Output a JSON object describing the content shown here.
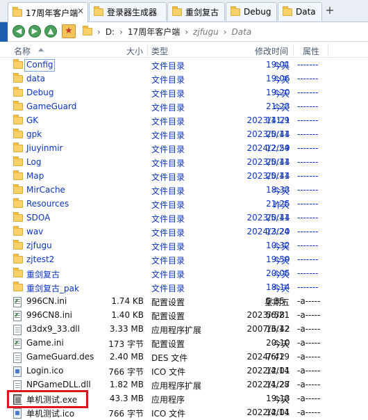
{
  "tabs": [
    {
      "label": "17周年客户端",
      "active": true
    },
    {
      "label": "登录器生成器",
      "active": false
    },
    {
      "label": "重剑复古",
      "active": false
    },
    {
      "label": "Debug",
      "active": false
    },
    {
      "label": "Data",
      "active": false
    }
  ],
  "tab_close_glyph": "✕",
  "tab_add_glyph": "+",
  "address": {
    "drive": "D:",
    "seg1": "17周年客户端",
    "seg2": "zjfugu",
    "seg3": "Data",
    "separator": "›"
  },
  "columns": {
    "name": "名称",
    "size": "大小",
    "type": "类型",
    "modified": "修改时间",
    "attr": "属性"
  },
  "folders": [
    {
      "name": "Config",
      "type": "文件目录",
      "date": "今天",
      "time": "19:01",
      "attr": "-------"
    },
    {
      "name": "data",
      "type": "文件目录",
      "date": "今天",
      "time": "19:06",
      "attr": "-------"
    },
    {
      "name": "Debug",
      "type": "文件目录",
      "date": "今天",
      "time": "19:20",
      "attr": "-------"
    },
    {
      "name": "GameGuard",
      "type": "文件目录",
      "date": "今天",
      "time": "21:23",
      "attr": "-------"
    },
    {
      "name": "GK",
      "type": "文件目录",
      "date": "2023/11/9",
      "time": "14:21",
      "attr": "-------"
    },
    {
      "name": "gpk",
      "type": "文件目录",
      "date": "2023/5/11",
      "time": "20:44",
      "attr": "-------"
    },
    {
      "name": "Jiuyinmir",
      "type": "文件目录",
      "date": "2024/2/24",
      "time": "12:59",
      "attr": "-------"
    },
    {
      "name": "Log",
      "type": "文件目录",
      "date": "2023/5/11",
      "time": "20:44",
      "attr": "-------"
    },
    {
      "name": "Map",
      "type": "文件目录",
      "date": "2023/5/11",
      "time": "20:44",
      "attr": "-------"
    },
    {
      "name": "MirCache",
      "type": "文件目录",
      "date": "今天",
      "time": "18:33",
      "attr": "-------"
    },
    {
      "name": "Resources",
      "type": "文件目录",
      "date": "昨天",
      "time": "21:25",
      "attr": "-------"
    },
    {
      "name": "SDOA",
      "type": "文件目录",
      "date": "2023/5/11",
      "time": "20:44",
      "attr": "-------"
    },
    {
      "name": "wav",
      "type": "文件目录",
      "date": "2024/2/24",
      "time": "13:20",
      "attr": "-------"
    },
    {
      "name": "zjfugu",
      "type": "文件目录",
      "date": "今天",
      "time": "10:32",
      "attr": "-------"
    },
    {
      "name": "zjtest2",
      "type": "文件目录",
      "date": "今天",
      "time": "19:59",
      "attr": "-------"
    },
    {
      "name": "重剑复古",
      "type": "文件目录",
      "date": "今天",
      "time": "20:05",
      "attr": "-------"
    },
    {
      "name": "重剑复古_pak",
      "type": "文件目录",
      "date": "今天",
      "time": "18:14",
      "attr": "-------"
    }
  ],
  "files": [
    {
      "name": "996CN.ini",
      "size": "1.74 KB",
      "type": "配置设置",
      "date": "星期五",
      "time": "5:35",
      "attr": "-a-----",
      "icon": "ini-file-icon"
    },
    {
      "name": "996CN8.ini",
      "size": "1.40 KB",
      "type": "配置设置",
      "date": "2023/6/21",
      "time": "5:58",
      "attr": "-a-----",
      "icon": "ini-file-icon"
    },
    {
      "name": "d3dx9_33.dll",
      "size": "3.33 MB",
      "type": "应用程序扩展",
      "date": "2007/3/12",
      "time": "16:42",
      "attr": "-a-----",
      "icon": "dll-file-icon"
    },
    {
      "name": "Game.ini",
      "size": "173 字节",
      "type": "配置设置",
      "date": "今天",
      "time": "20:10",
      "attr": "-a-----",
      "icon": "ini-file-icon"
    },
    {
      "name": "GameGuard.des",
      "size": "2.40 MB",
      "type": "DES 文件",
      "date": "2024/6/19",
      "time": "7:42",
      "attr": "-a-----",
      "icon": "des-file-icon"
    },
    {
      "name": "Login.ico",
      "size": "766 字节",
      "type": "ICO 文件",
      "date": "2022/4/14",
      "time": "12:01",
      "attr": "-a-----",
      "icon": "ico-file-icon"
    },
    {
      "name": "NPGameDLL.dll",
      "size": "1.82 MB",
      "type": "应用程序扩展",
      "date": "2022/4/28",
      "time": "11:27",
      "attr": "-a-----",
      "icon": "dll-file-icon"
    },
    {
      "name": "单机测试.exe",
      "size": "43.3 MB",
      "type": "应用程序",
      "date": "今天",
      "time": "19:13",
      "attr": "-a-----",
      "icon": "exe-file-icon"
    },
    {
      "name": "单机测试.ico",
      "size": "766 字节",
      "type": "ICO 文件",
      "date": "2022/4/14",
      "time": "12:01",
      "attr": "-a-----",
      "icon": "ico-file-icon"
    }
  ],
  "colors": {
    "folder_text": "#0b34c2",
    "highlight": "#e0141b",
    "nav_green": "#4aa05a"
  }
}
